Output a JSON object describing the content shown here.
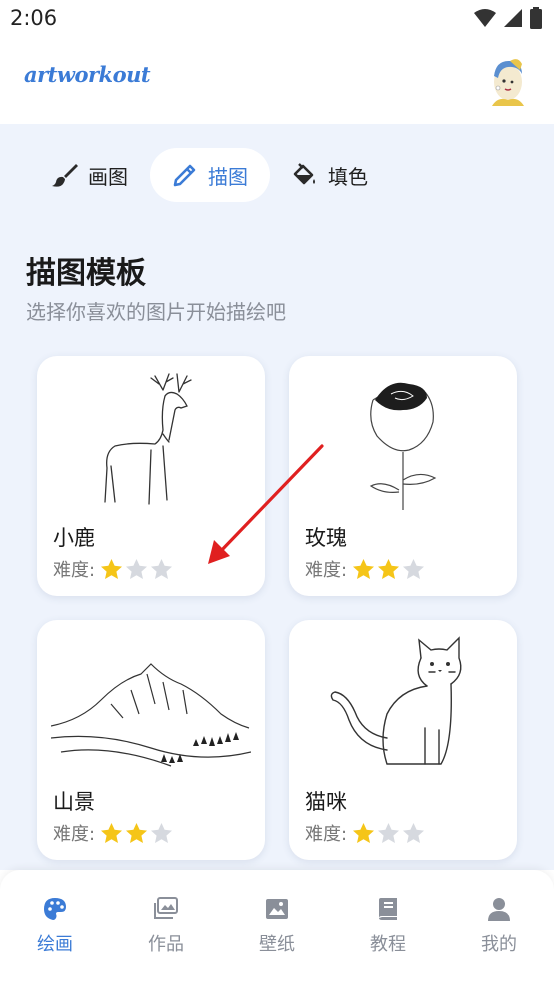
{
  "status_bar": {
    "time": "2:06"
  },
  "app": {
    "logo": "artworkout"
  },
  "tabs": [
    {
      "label": "画图",
      "icon": "brush-icon",
      "active": false
    },
    {
      "label": "描图",
      "icon": "pencil-icon",
      "active": true
    },
    {
      "label": "填色",
      "icon": "paint-bucket-icon",
      "active": false
    }
  ],
  "section": {
    "title": "描图模板",
    "subtitle": "选择你喜欢的图片开始描绘吧"
  },
  "difficulty_label": "难度:",
  "templates": [
    {
      "name": "小鹿",
      "image": "deer-drawing",
      "difficulty": 1,
      "max_difficulty": 3
    },
    {
      "name": "玫瑰",
      "image": "rose-drawing",
      "difficulty": 2,
      "max_difficulty": 3
    },
    {
      "name": "山景",
      "image": "mountain-drawing",
      "difficulty": 2,
      "max_difficulty": 3
    },
    {
      "name": "猫咪",
      "image": "cat-drawing",
      "difficulty": 1,
      "max_difficulty": 3
    }
  ],
  "bottom_nav": [
    {
      "label": "绘画",
      "icon": "palette-icon",
      "active": true
    },
    {
      "label": "作品",
      "icon": "gallery-icon",
      "active": false
    },
    {
      "label": "壁纸",
      "icon": "image-icon",
      "active": false
    },
    {
      "label": "教程",
      "icon": "book-icon",
      "active": false
    },
    {
      "label": "我的",
      "icon": "person-icon",
      "active": false
    }
  ],
  "colors": {
    "accent": "#3b7bd6",
    "content_bg": "#eef3fc",
    "star_filled": "#f5c518",
    "star_empty": "#d6d9df",
    "annotation_arrow": "#e02020"
  }
}
